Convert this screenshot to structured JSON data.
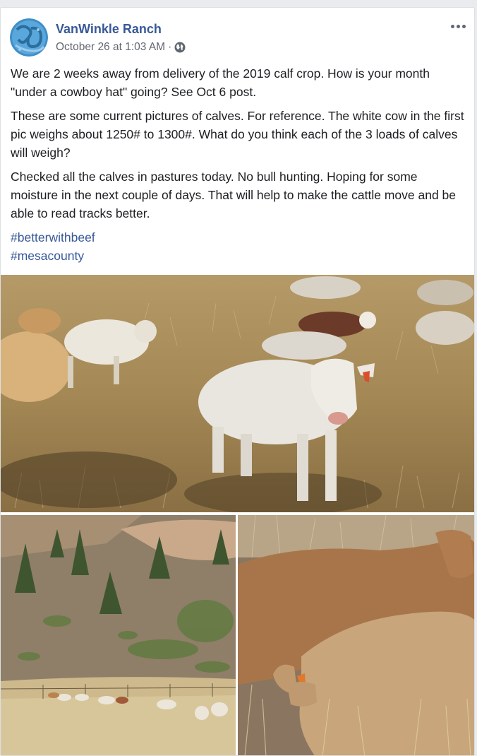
{
  "post": {
    "author": "VanWinkle Ranch",
    "timestamp": "October 26 at 1:03 AM",
    "separator": "·",
    "privacy_icon": "globe-icon",
    "menu_icon": "more-options-icon",
    "paragraphs": [
      "We are 2 weeks away from delivery of the 2019 calf crop. How is your month \"under a cowboy hat\" going? See Oct 6 post.",
      "These are some current pictures of calves. For reference. The white cow in the first pic weighs about 1250# to 1300#. What do you think each of the 3 loads of calves will weigh?",
      "Checked all the calves in pastures today. No bull hunting. Hoping for some moisture in the next couple of days. That will help to make the cattle move and be able to read tracks better."
    ],
    "hashtags": [
      "#betterwithbeef",
      "#mesacounty"
    ],
    "photos": [
      "photo-white-calves-pasture",
      "photo-hillside-pasture-herd",
      "photo-tan-calves-closeup"
    ]
  },
  "colors": {
    "link": "#385898",
    "text": "#1c1e21",
    "meta": "#616770",
    "page_bg": "#e9ebee"
  }
}
